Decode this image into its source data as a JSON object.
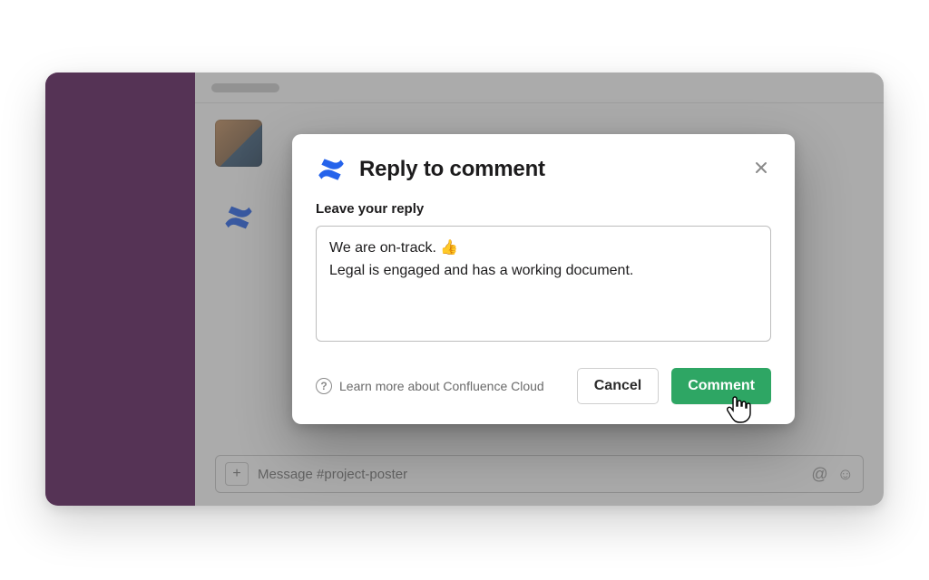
{
  "composer": {
    "placeholder": "Message #project-poster"
  },
  "modal": {
    "title": "Reply to comment",
    "subhead": "Leave your reply",
    "reply_value": "We are on-track. 👍\nLegal is engaged and has a working document.",
    "help_text": "Learn more about Confluence Cloud",
    "cancel_label": "Cancel",
    "submit_label": "Comment"
  },
  "colors": {
    "sidebar": "#5a1a5a",
    "primary_btn": "#2ea664"
  }
}
